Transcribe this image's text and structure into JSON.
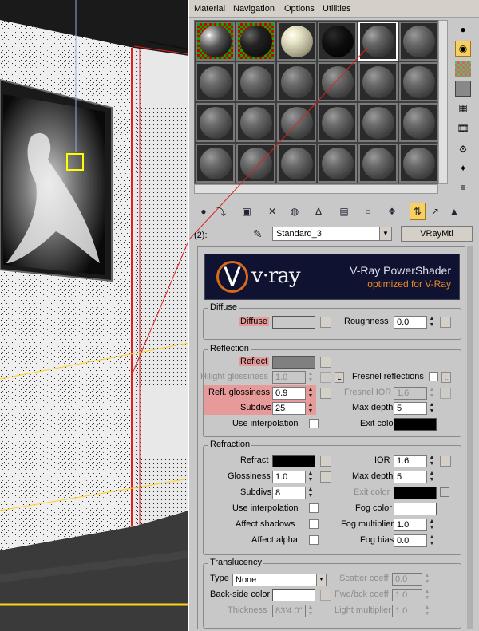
{
  "menu": [
    "Material",
    "Navigation",
    "Options",
    "Utilities"
  ],
  "slots": {
    "rows": [
      [
        "chrome",
        "dark",
        "cream",
        "black",
        "shiny",
        "gray"
      ],
      [
        "gray",
        "gray",
        "gray",
        "gray",
        "gray",
        "gray"
      ],
      [
        "gray",
        "gray",
        "gray",
        "gray",
        "gray",
        "gray"
      ],
      [
        "gray",
        "gray",
        "gray",
        "gray",
        "gray",
        "gray"
      ]
    ],
    "active_index": 4
  },
  "side_tools": [
    "sphere-icon",
    "backlight-icon",
    "checker-background-icon",
    "sample-uv-icon",
    "video-color-check-icon",
    "make-preview-icon",
    "options-icon",
    "select-by-material-icon",
    "material-navigator-icon"
  ],
  "bottom_tools": [
    "get-material-icon",
    "put-to-scene-icon",
    "assign-to-selection-icon",
    "reset-map-icon",
    "make-unique-icon",
    "put-to-library-icon",
    "material-effects-channel-icon",
    "show-map-icon",
    "show-end-result-icon",
    "go-to-parent-icon",
    "go-forward-icon"
  ],
  "name_row": {
    "slot_label": "(2):",
    "material_name": "Standard_3",
    "type_button": "VRayMtl"
  },
  "banner": {
    "logo": "v·ray",
    "title": "V-Ray PowerShader",
    "subtitle": "optimized for V-Ray"
  },
  "diffuse": {
    "group_label": "Diffuse",
    "diffuse_label": "Diffuse",
    "diffuse_color": "#c8c8c8",
    "roughness_label": "Roughness",
    "roughness_value": "0.0"
  },
  "reflection": {
    "group_label": "Reflection",
    "reflect_label": "Reflect",
    "reflect_color": "#808080",
    "hilight_label": "Hilight glossiness",
    "hilight_value": "1.0",
    "lock_label": "L",
    "fresnel_label": "Fresnel reflections",
    "refl_gloss_label": "Refl. glossiness",
    "refl_gloss_value": "0.9",
    "fresnel_ior_label": "Fresnel IOR",
    "fresnel_ior_value": "1.6",
    "subdivs_label": "Subdivs",
    "subdivs_value": "25",
    "max_depth_label": "Max depth",
    "max_depth_value": "5",
    "use_interp_label": "Use interpolation",
    "exit_color_label": "Exit color",
    "exit_color": "#000000"
  },
  "refraction": {
    "group_label": "Refraction",
    "refract_label": "Refract",
    "refract_color": "#000000",
    "ior_label": "IOR",
    "ior_value": "1.6",
    "gloss_label": "Glossiness",
    "gloss_value": "1.0",
    "max_depth_label": "Max depth",
    "max_depth_value": "5",
    "subdivs_label": "Subdivs",
    "subdivs_value": "8",
    "exit_color_label": "Exit color",
    "use_interp_label": "Use interpolation",
    "fog_color_label": "Fog color",
    "fog_color": "#ffffff",
    "affect_shadows_label": "Affect shadows",
    "fog_mult_label": "Fog multiplier",
    "fog_mult_value": "1.0",
    "affect_alpha_label": "Affect alpha",
    "fog_bias_label": "Fog bias",
    "fog_bias_value": "0.0"
  },
  "translucency": {
    "group_label": "Translucency",
    "type_label": "Type",
    "type_value": "None",
    "scatter_label": "Scatter coeff",
    "scatter_value": "0.0",
    "backside_label": "Back-side color",
    "backside_color": "#ffffff",
    "fwdbck_label": "Fwd/bck coeff",
    "fwdbck_value": "1.0",
    "thickness_label": "Thickness",
    "thickness_value": "83'4.0\"",
    "light_mult_label": "Light multiplier",
    "light_mult_value": "1.0"
  },
  "colors": {
    "highlight": "#e79a9a",
    "accent": "#f7d060"
  }
}
